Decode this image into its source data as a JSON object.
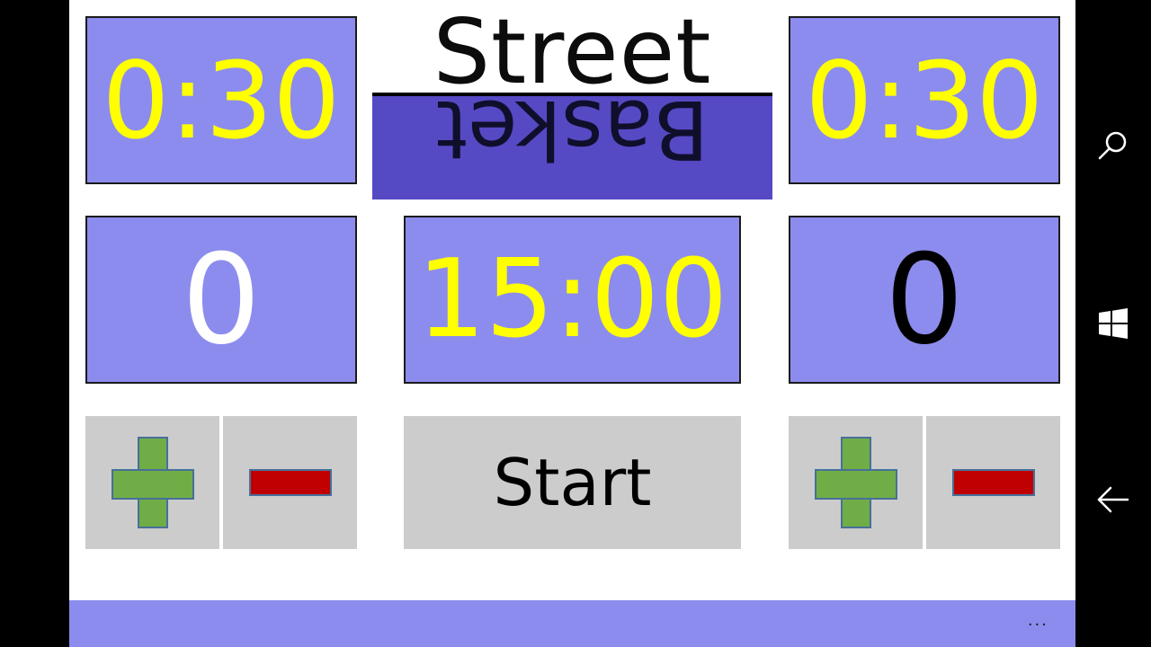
{
  "left_team": {
    "possession_timer": "0:30",
    "score": "0",
    "plus_icon": "plus-icon",
    "minus_icon": "minus-icon"
  },
  "right_team": {
    "possession_timer": "0:30",
    "score": "0",
    "plus_icon": "plus-icon",
    "minus_icon": "minus-icon"
  },
  "game_clock": "15:00",
  "start_label": "Start",
  "logo": {
    "top_word": "Street",
    "bottom_word": "Basket"
  },
  "app_bar": {
    "more_label": "..."
  },
  "nav_bar": {
    "icons": [
      "search-icon",
      "windows-icon",
      "back-icon"
    ]
  },
  "colors": {
    "panel": "#8c8cee",
    "timer_text": "#ffff00",
    "left_score_text": "#ffffff",
    "right_score_text": "#000000",
    "button_bg": "#cccccc",
    "plus": "#70ad47",
    "minus": "#c00000",
    "app_bar": "#8c8cee"
  }
}
